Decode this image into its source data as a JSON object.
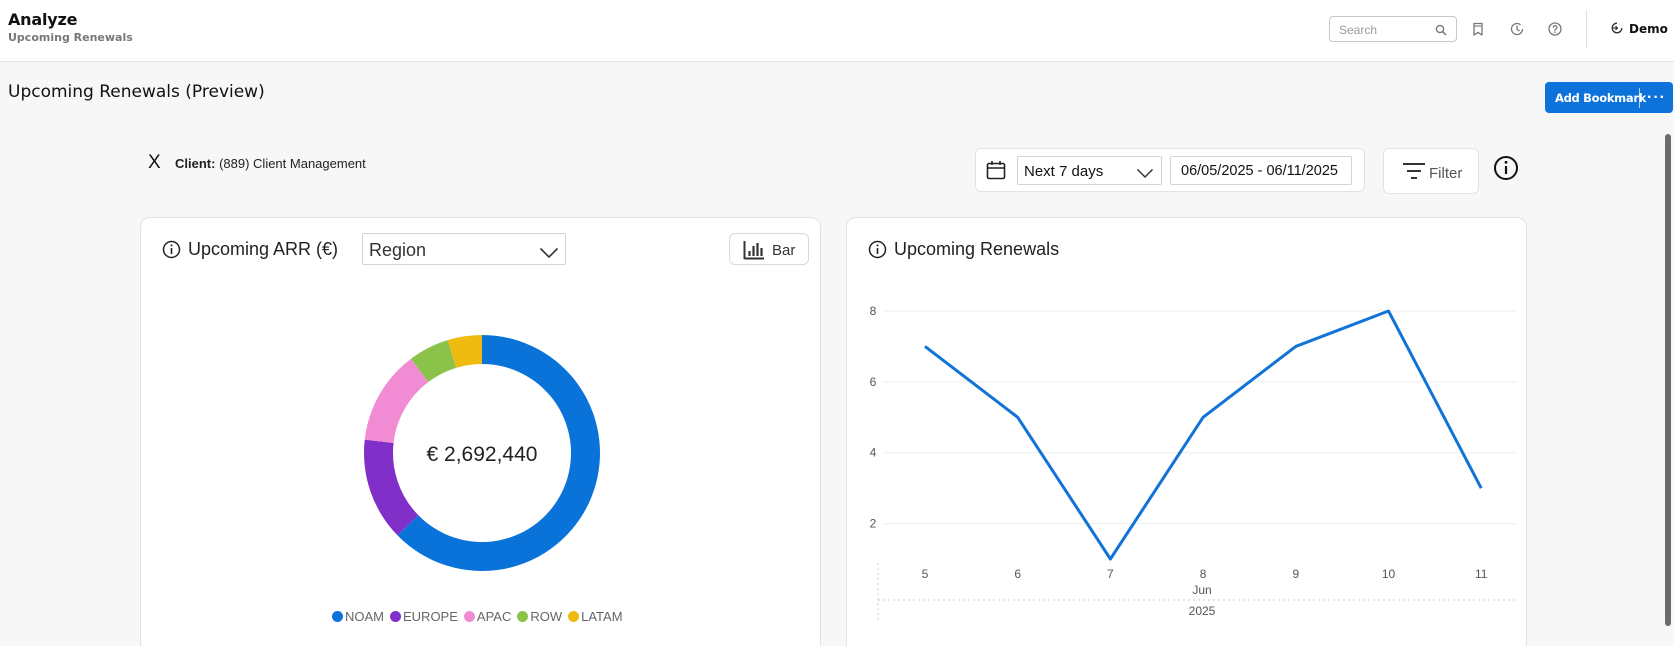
{
  "header": {
    "app_title": "Analyze",
    "subtitle": "Upcoming Renewals",
    "search_placeholder": "Search",
    "user": "Demo"
  },
  "page": {
    "title": "Upcoming Renewals (Preview)",
    "add_bookmark_label": "Add Bookmark",
    "more_label": "···"
  },
  "client_filter": {
    "remove": "X",
    "label": "Client:",
    "value": "(889) Client Management"
  },
  "date_filter": {
    "range": "Next 7 days",
    "dates": "06/05/2025 - 06/11/2025"
  },
  "filter_button": "Filter",
  "left_card": {
    "title": "Upcoming ARR (€)",
    "group_by": "Region",
    "chart_type_button": "Bar",
    "center_label": "€ 2,692,440"
  },
  "right_card": {
    "title": "Upcoming Renewals"
  },
  "colors": {
    "accent": "#0d72d9",
    "NOAM": "#0a73da",
    "EUROPE": "#8030c8",
    "APAC": "#f18bd4",
    "ROW": "#8bc34a",
    "LATAM": "#f0bb10"
  },
  "chart_data": [
    {
      "type": "pie",
      "title": "Upcoming ARR (€)",
      "categories": [
        "NOAM",
        "EUROPE",
        "APAC",
        "ROW",
        "LATAM"
      ],
      "values": [
        0.627,
        0.141,
        0.129,
        0.056,
        0.047
      ],
      "total": "€ 2,692,440",
      "legend": "bottom"
    },
    {
      "type": "line",
      "title": "Upcoming Renewals",
      "series": [
        {
          "values": [
            7,
            5,
            1,
            5,
            7,
            8,
            3
          ]
        }
      ],
      "x": [
        "5",
        "6",
        "7",
        "8",
        "9",
        "10",
        "11"
      ],
      "x_group_label": "Jun",
      "x_year_label": "2025",
      "yticks": [
        "2",
        "4",
        "6",
        "8"
      ],
      "ylim": [
        1,
        8
      ],
      "grid": true
    }
  ]
}
